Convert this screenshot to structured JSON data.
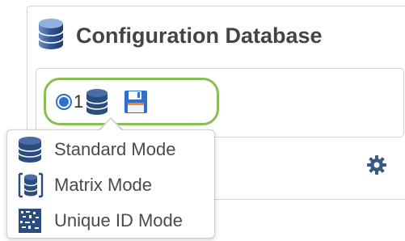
{
  "panel": {
    "title": "Configuration Database",
    "title_icon": "database-icon"
  },
  "selector": {
    "selected": true,
    "index_label": "1",
    "icons": [
      "database-icon",
      "save-icon"
    ]
  },
  "settings": {
    "icon": "gear-icon"
  },
  "mode_menu": {
    "items": [
      {
        "label": "Standard Mode",
        "icon": "database-icon"
      },
      {
        "label": "Matrix Mode",
        "icon": "matrix-database-icon"
      },
      {
        "label": "Unique ID Mode",
        "icon": "unique-id-database-icon"
      }
    ]
  },
  "colors": {
    "accent_blue": "#2f6fd1",
    "pill_border": "#8bbd56",
    "icon_navy": "#2b4c7e",
    "title_text": "#444444"
  }
}
